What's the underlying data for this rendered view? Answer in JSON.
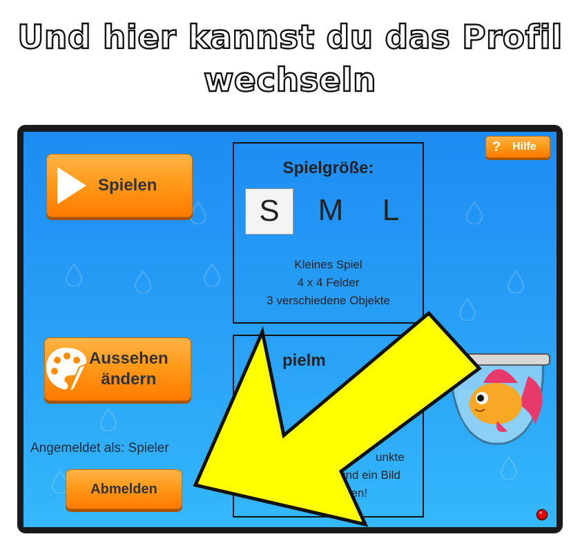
{
  "headline": {
    "line1": "Und hier kannst du das Profil",
    "line2": "wechseln"
  },
  "buttons": {
    "play": "Spielen",
    "look_line1": "Aussehen",
    "look_line2": "ändern",
    "logout": "Abmelden",
    "help": "Hilfe",
    "help_glyph": "?"
  },
  "game_size": {
    "title": "Spielgröße:",
    "options": [
      "S",
      "M",
      "L"
    ],
    "selected": "S",
    "desc_line1": "Kleines Spiel",
    "desc_line2": "4 x 4 Felder",
    "desc_line3": "3 verschiedene Objekte"
  },
  "game_mode": {
    "title_partial": "pielm",
    "text_line1": "unkte",
    "text_line2": "und ein Bild",
    "text_line3": "den!"
  },
  "login": {
    "status": "Angemeldet als: Spieler"
  },
  "colors": {
    "background": "#2196f3",
    "button": "#ff8c00",
    "arrow": "#ffff00",
    "status_light": "#e00000"
  },
  "icons": [
    "play-triangle-icon",
    "palette-icon",
    "help-icon",
    "fishbowl-icon",
    "status-light-icon",
    "pointer-arrow-icon"
  ]
}
